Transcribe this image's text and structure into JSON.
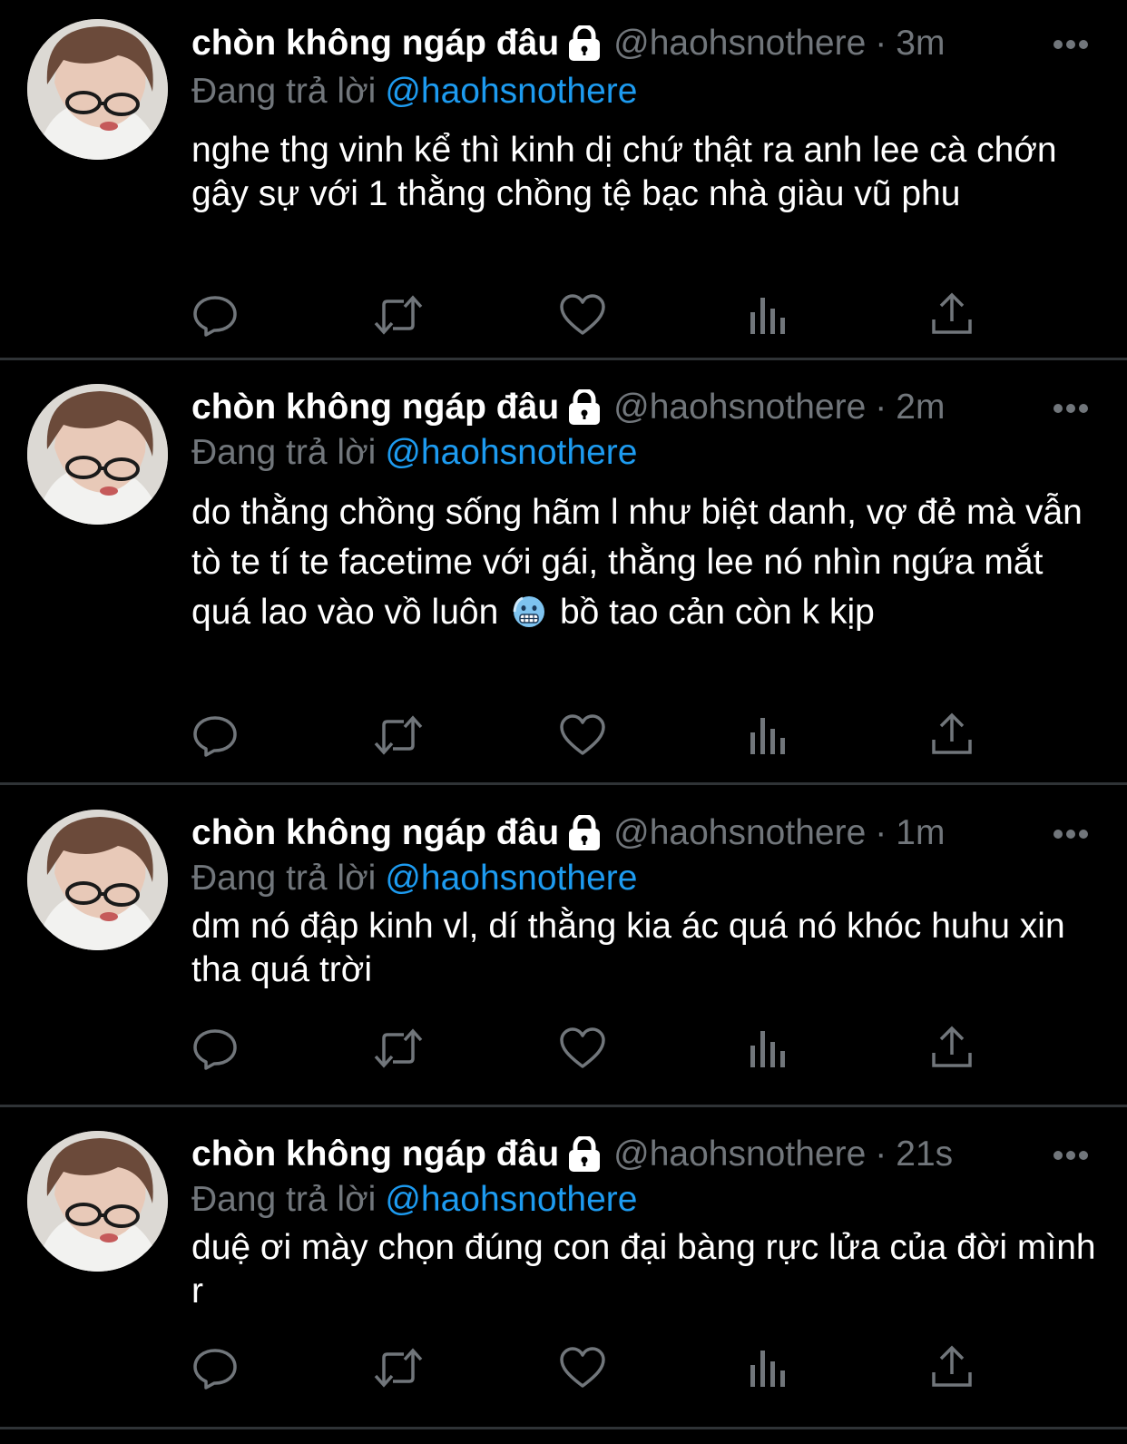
{
  "colors": {
    "background": "#000000",
    "name": "#ffffff",
    "secondary": "#71767b",
    "link": "#1d9bf0",
    "divider": "#2f3336"
  },
  "tweets": [
    {
      "display_name": "chòn không ngáp đâu",
      "handle": "@haohsnothere",
      "dot": "·",
      "time": "3m",
      "replying_prefix": "Đang trả lời",
      "replying_to": "@haohsnothere",
      "text": "nghe thg vinh kể thì kinh dị chứ thật ra anh lee cà chớn gây sự với 1 thằng chồng tệ bạc nhà giàu vũ phu"
    },
    {
      "display_name": "chòn không ngáp đâu",
      "handle": "@haohsnothere",
      "dot": "·",
      "time": "2m",
      "replying_prefix": "Đang trả lời",
      "replying_to": "@haohsnothere",
      "text_before_emoji": "do thằng chồng sống hãm l như biệt danh, vợ đẻ mà vẫn tò te tí te facetime với gái, thằng lee nó nhìn ngứa mắt quá lao vào vồ luôn",
      "emoji": "cold-face-emoji",
      "text_after_emoji": "bồ tao cản còn k kịp"
    },
    {
      "display_name": "chòn không ngáp đâu",
      "handle": "@haohsnothere",
      "dot": "·",
      "time": "1m",
      "replying_prefix": "Đang trả lời",
      "replying_to": "@haohsnothere",
      "text": "dm nó đập kinh vl, dí thằng kia ác quá nó khóc huhu xin tha quá trời"
    },
    {
      "display_name": "chòn không ngáp đâu",
      "handle": "@haohsnothere",
      "dot": "·",
      "time": "21s",
      "replying_prefix": "Đang trả lời",
      "replying_to": "@haohsnothere",
      "text": "duệ ơi mày chọn đúng con đại bàng rực lửa của đời mình r"
    }
  ],
  "icons": {
    "lock": "lock-icon",
    "more": "more-options-icon",
    "reply": "reply-icon",
    "retweet": "retweet-icon",
    "like": "like-icon",
    "views": "views-icon",
    "share": "share-icon"
  }
}
